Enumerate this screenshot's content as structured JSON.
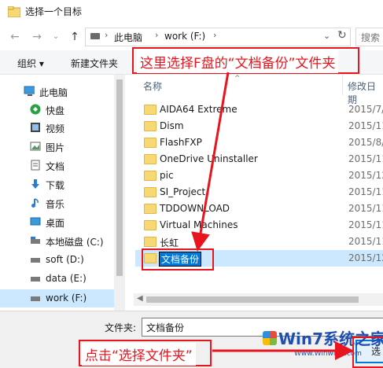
{
  "window": {
    "title": "选择一个目标"
  },
  "address": {
    "breadcrumbs": [
      "此电脑",
      "work (F:)"
    ],
    "search_placeholder": "搜索"
  },
  "toolbar": {
    "organize": "组织 ▾",
    "new_folder": "新建文件夹"
  },
  "sidebar": {
    "items": [
      {
        "label": "此电脑",
        "icon": "computer-icon"
      },
      {
        "label": "快盘",
        "icon": "kuaipan-icon"
      },
      {
        "label": "视频",
        "icon": "video-icon"
      },
      {
        "label": "图片",
        "icon": "pictures-icon"
      },
      {
        "label": "文档",
        "icon": "documents-icon"
      },
      {
        "label": "下载",
        "icon": "downloads-icon"
      },
      {
        "label": "音乐",
        "icon": "music-icon"
      },
      {
        "label": "桌面",
        "icon": "desktop-icon"
      },
      {
        "label": "本地磁盘 (C:)",
        "icon": "drive-icon"
      },
      {
        "label": "soft (D:)",
        "icon": "drive-icon"
      },
      {
        "label": "data (E:)",
        "icon": "drive-icon"
      },
      {
        "label": "work (F:)",
        "icon": "drive-icon"
      }
    ]
  },
  "list": {
    "columns": [
      "名称",
      "修改日期"
    ],
    "rows": [
      {
        "name": "AIDA64 Extreme",
        "date": "2015/7/"
      },
      {
        "name": "Dism",
        "date": "2015/11"
      },
      {
        "name": "FlashFXP",
        "date": "2015/8/"
      },
      {
        "name": "OneDrive Uninstaller",
        "date": "2015/11"
      },
      {
        "name": "pic",
        "date": "2015/12"
      },
      {
        "name": "SI_Project",
        "date": "2015/11"
      },
      {
        "name": "TDDOWNLOAD",
        "date": "2015/11"
      },
      {
        "name": "Virtual Machines",
        "date": "2015/11"
      },
      {
        "name": "长虹",
        "date": "2015/11"
      },
      {
        "name": "文档备份",
        "date": "2015/12"
      }
    ]
  },
  "bottom": {
    "folder_label": "文件夹:",
    "folder_value": "文档备份",
    "select_button": "选"
  },
  "annotations": {
    "top_callout": "这里选择F盘的“文档备份”文件夹",
    "bottom_callout": "点击“选择文件夹”",
    "color": "#e8141e"
  },
  "watermark": {
    "brand": "Win7系统之家",
    "url": "Www.Winwin7.com"
  }
}
